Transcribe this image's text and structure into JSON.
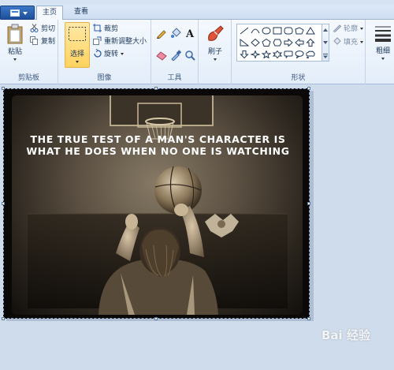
{
  "tabs": {
    "home": "主页",
    "view": "查看"
  },
  "clipboard": {
    "paste": "粘贴",
    "cut": "剪切",
    "copy": "复制",
    "label": "剪贴板"
  },
  "image": {
    "select": "选择",
    "crop": "裁剪",
    "resize": "重新调整大小",
    "rotate": "旋转",
    "label": "图像"
  },
  "tools": {
    "label": "工具"
  },
  "brushes": {
    "label": "刷子"
  },
  "shapes": {
    "outline": "轮廓",
    "fill": "填充",
    "label": "形状"
  },
  "thickness": {
    "label": "粗细"
  },
  "canvas": {
    "line1": "THE TRUE TEST OF A MAN'S CHARACTER IS",
    "line2": "WHAT HE DOES WHEN NO ONE IS WATCHING"
  },
  "watermark": "Bai 经验"
}
